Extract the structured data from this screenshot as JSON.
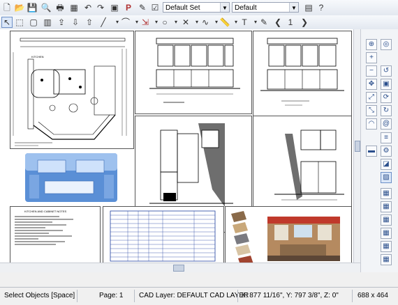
{
  "toolbar_top": {
    "layer_set_select": "Default Set",
    "default_select": "Default"
  },
  "toolbar_draw": {
    "page_number": "1"
  },
  "sheets": {
    "kitchen_plan_title": "KITCHEN",
    "notes_title": "KITCHEN AND CABINET NOTES"
  },
  "status": {
    "mode": "Select Objects [Space]",
    "page": "Page: 1",
    "cad_layer": "CAD Layer:  DEFAULT CAD LAYER",
    "coordinates": "X: 877 11/16\", Y: 797 3/8\", Z: 0\"",
    "dimensions": "688 x 464"
  },
  "colors": {
    "toolbar_bg": "#e3e8f0",
    "canvas_bg": "#ffffff",
    "render_blue": "#5a8fd6",
    "accent_red": "#c0392b"
  }
}
